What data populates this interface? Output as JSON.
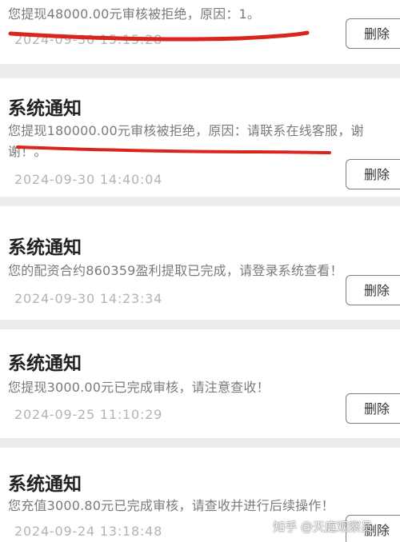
{
  "notifications": [
    {
      "title": "",
      "message": "您提现48000.00元审核被拒绝，原因：1。",
      "time": "2024-09-30 15:15:28",
      "delete_label": "删除"
    },
    {
      "title": "系统通知",
      "message": "您提现180000.00元审核被拒绝，原因：请联系在线客服，谢谢！。",
      "time": "2024-09-30 14:40:04",
      "delete_label": "删除"
    },
    {
      "title": "系统通知",
      "message": "您的配资合约860359盈利提取已完成，请登录系统查看！",
      "time": "2024-09-30 14:23:34",
      "delete_label": "删除"
    },
    {
      "title": "系统通知",
      "message": "您提现3000.00元已完成审核，请注意查收！",
      "time": "2024-09-25 11:10:29",
      "delete_label": "删除"
    },
    {
      "title": "系统通知",
      "message": "您充值3000.80元已完成审核，请查收并进行后续操作！",
      "time": "2024-09-24 13:18:48",
      "delete_label": "删除"
    }
  ],
  "watermark": "知乎 @天庭观察员",
  "colors": {
    "annotation_red": "#d8251d",
    "background": "#ececec",
    "card": "#ffffff"
  }
}
